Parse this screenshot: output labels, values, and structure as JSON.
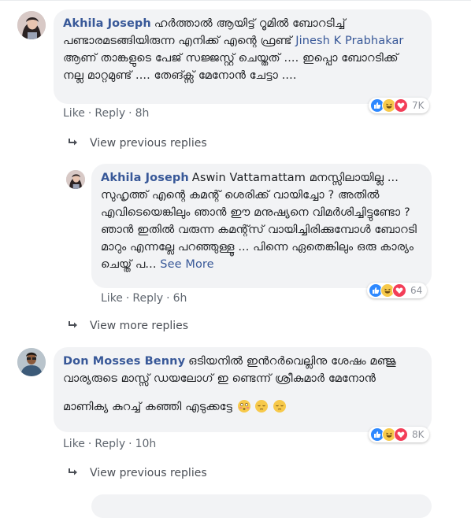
{
  "comments": [
    {
      "author": "Akhila Joseph",
      "text_a": "ഹർത്താൽ ആയിട്ട് റൂമിൽ ബോറടിച്ച് പണ്ടാരമടങ്ങിയിരുന്ന എനിക്ക് എന്റെ ഫ്രണ്ട് ",
      "mention": "Jinesh K Prabhakar",
      "text_b": " ആണ് താങ്കളുടെ പേജ് സജ്ജസ്റ്റ് ചെയ്തത് .... ഇപ്പൊ ബോറടിക്ക് നല്ല മാറ്റമുണ്ട് .... തേങ്ക്സ് മേനോൻ ചേട്ടാ ....",
      "like": "Like",
      "reply": "Reply",
      "time": "8h",
      "reaction_count": "7K",
      "reactions": [
        "like",
        "haha",
        "love"
      ]
    },
    {
      "author": "Akhila Joseph",
      "mention": "Aswin Vattamattam",
      "text": " മനസ്സിലായില്ല ... സുഹൃത്ത് എന്റെ കമന്റ് ശെരിക്ക് വായിച്ചോ ? അതിൽ എവിടെയെങ്കിലും ഞാൻ ഈ മനുഷ്യനെ വിമർശിച്ചിട്ടുണ്ടോ ? ഞാൻ ഇതിൽ വരുന്ന കമന്റ്സ് വായിച്ചിരിക്കുമ്പോൾ ബോറടി മാറും എന്നല്ലേ പറഞ്ഞുള്ളൂ ... പിന്നെ ഏതെങ്കിലും ഒരു കാര്യം ചെയ്ത് പ...",
      "see_more": "See More",
      "like": "Like",
      "reply": "Reply",
      "time": "6h",
      "reaction_count": "64",
      "reactions": [
        "like",
        "haha",
        "love"
      ]
    },
    {
      "author": "Don Mosses Benny",
      "text_a": "ഒടിയനിൽ ഇൻറർവെല്ലിനു ശേഷം മഞ്ജു വാര്യരുടെ മാസ്സ് ഡയലോഗ് ഇ ണ്ടെന്ന് ശ്രീകുമാർ മേനോൻ",
      "text_b": "മാണിക്യ കുറച്ച് കഞ്ഞി എടുക്കട്ടേ",
      "like": "Like",
      "reply": "Reply",
      "time": "10h",
      "reaction_count": "8K",
      "reactions": [
        "like",
        "haha",
        "love"
      ]
    }
  ],
  "reply_links": {
    "first": "View previous replies",
    "more": "View more replies",
    "second": "View previous replies"
  },
  "colors": {
    "link": "#385898",
    "bubble": "#f2f3f5",
    "like_blue": "#2d88ff",
    "haha_yellow": "#f7c94a",
    "love_red": "#f33e58"
  }
}
